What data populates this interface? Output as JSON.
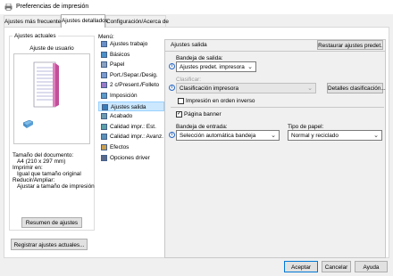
{
  "window": {
    "title": "Preferencias de impresión"
  },
  "tabs": [
    {
      "label": "Ajustes más frecuentes"
    },
    {
      "label": "Ajustes detallados"
    },
    {
      "label": "Configuración/Acerca de"
    }
  ],
  "current_settings": {
    "group_label": "Ajustes actuales",
    "preview_title": "Ajuste de usuario",
    "summary": [
      "Tamaño del documento:",
      "A4 (210 x 297 mm)",
      "Imprimir en:",
      "Igual que tamaño original",
      "Reducir/Ampliar:",
      "Ajustar a tamaño de impresión"
    ],
    "summary_button": "Resumen de ajustes",
    "register_button": "Registrar ajustes actuales..."
  },
  "menu": {
    "label": "Menú:",
    "items": [
      {
        "label": "Ajustes trabajo",
        "icon": "job-settings-icon"
      },
      {
        "label": "Básicos",
        "icon": "basic-icon"
      },
      {
        "label": "Papel",
        "icon": "paper-icon"
      },
      {
        "label": "Port./Separ./Desig.",
        "icon": "cover-icon"
      },
      {
        "label": "2 c/Present./Folleto",
        "icon": "booklet-icon"
      },
      {
        "label": "Imposición",
        "icon": "imposition-icon"
      },
      {
        "label": "Ajustes salida",
        "icon": "output-settings-icon",
        "selected": true
      },
      {
        "label": "Acabado",
        "icon": "finishing-icon"
      },
      {
        "label": "Calidad impr.: Est.",
        "icon": "quality-standard-icon"
      },
      {
        "label": "Calidad impr.: Avanz.",
        "icon": "quality-advanced-icon"
      },
      {
        "label": "Efectos",
        "icon": "effects-icon"
      },
      {
        "label": "Opciones driver",
        "icon": "driver-options-icon"
      }
    ]
  },
  "panel": {
    "title": "Ajustes salida",
    "restore_button": "Restaurar ajustes predet.",
    "output_tray_label": "Bandeja de salida:",
    "output_tray_value": "Ajustes predet. impresora",
    "classify_label": "Clasificar:",
    "classify_value": "Clasificación impresora",
    "classify_details_button": "Detalles clasificación...",
    "reverse_order_label": "Impresión en orden inverso",
    "reverse_order_checked": false,
    "banner_page_label": "Página banner",
    "banner_page_checked": true,
    "input_tray_label": "Bandeja de entrada:",
    "input_tray_value": "Selección automática bandeja",
    "paper_type_label": "Tipo de papel:",
    "paper_type_value": "Normal y reciclado"
  },
  "footer": {
    "ok": "Aceptar",
    "cancel": "Cancelar",
    "help": "Ayuda"
  },
  "colors": {
    "accent": "#0078d7",
    "selection": "#cce8ff",
    "panel_bg": "#f0f0f0"
  }
}
